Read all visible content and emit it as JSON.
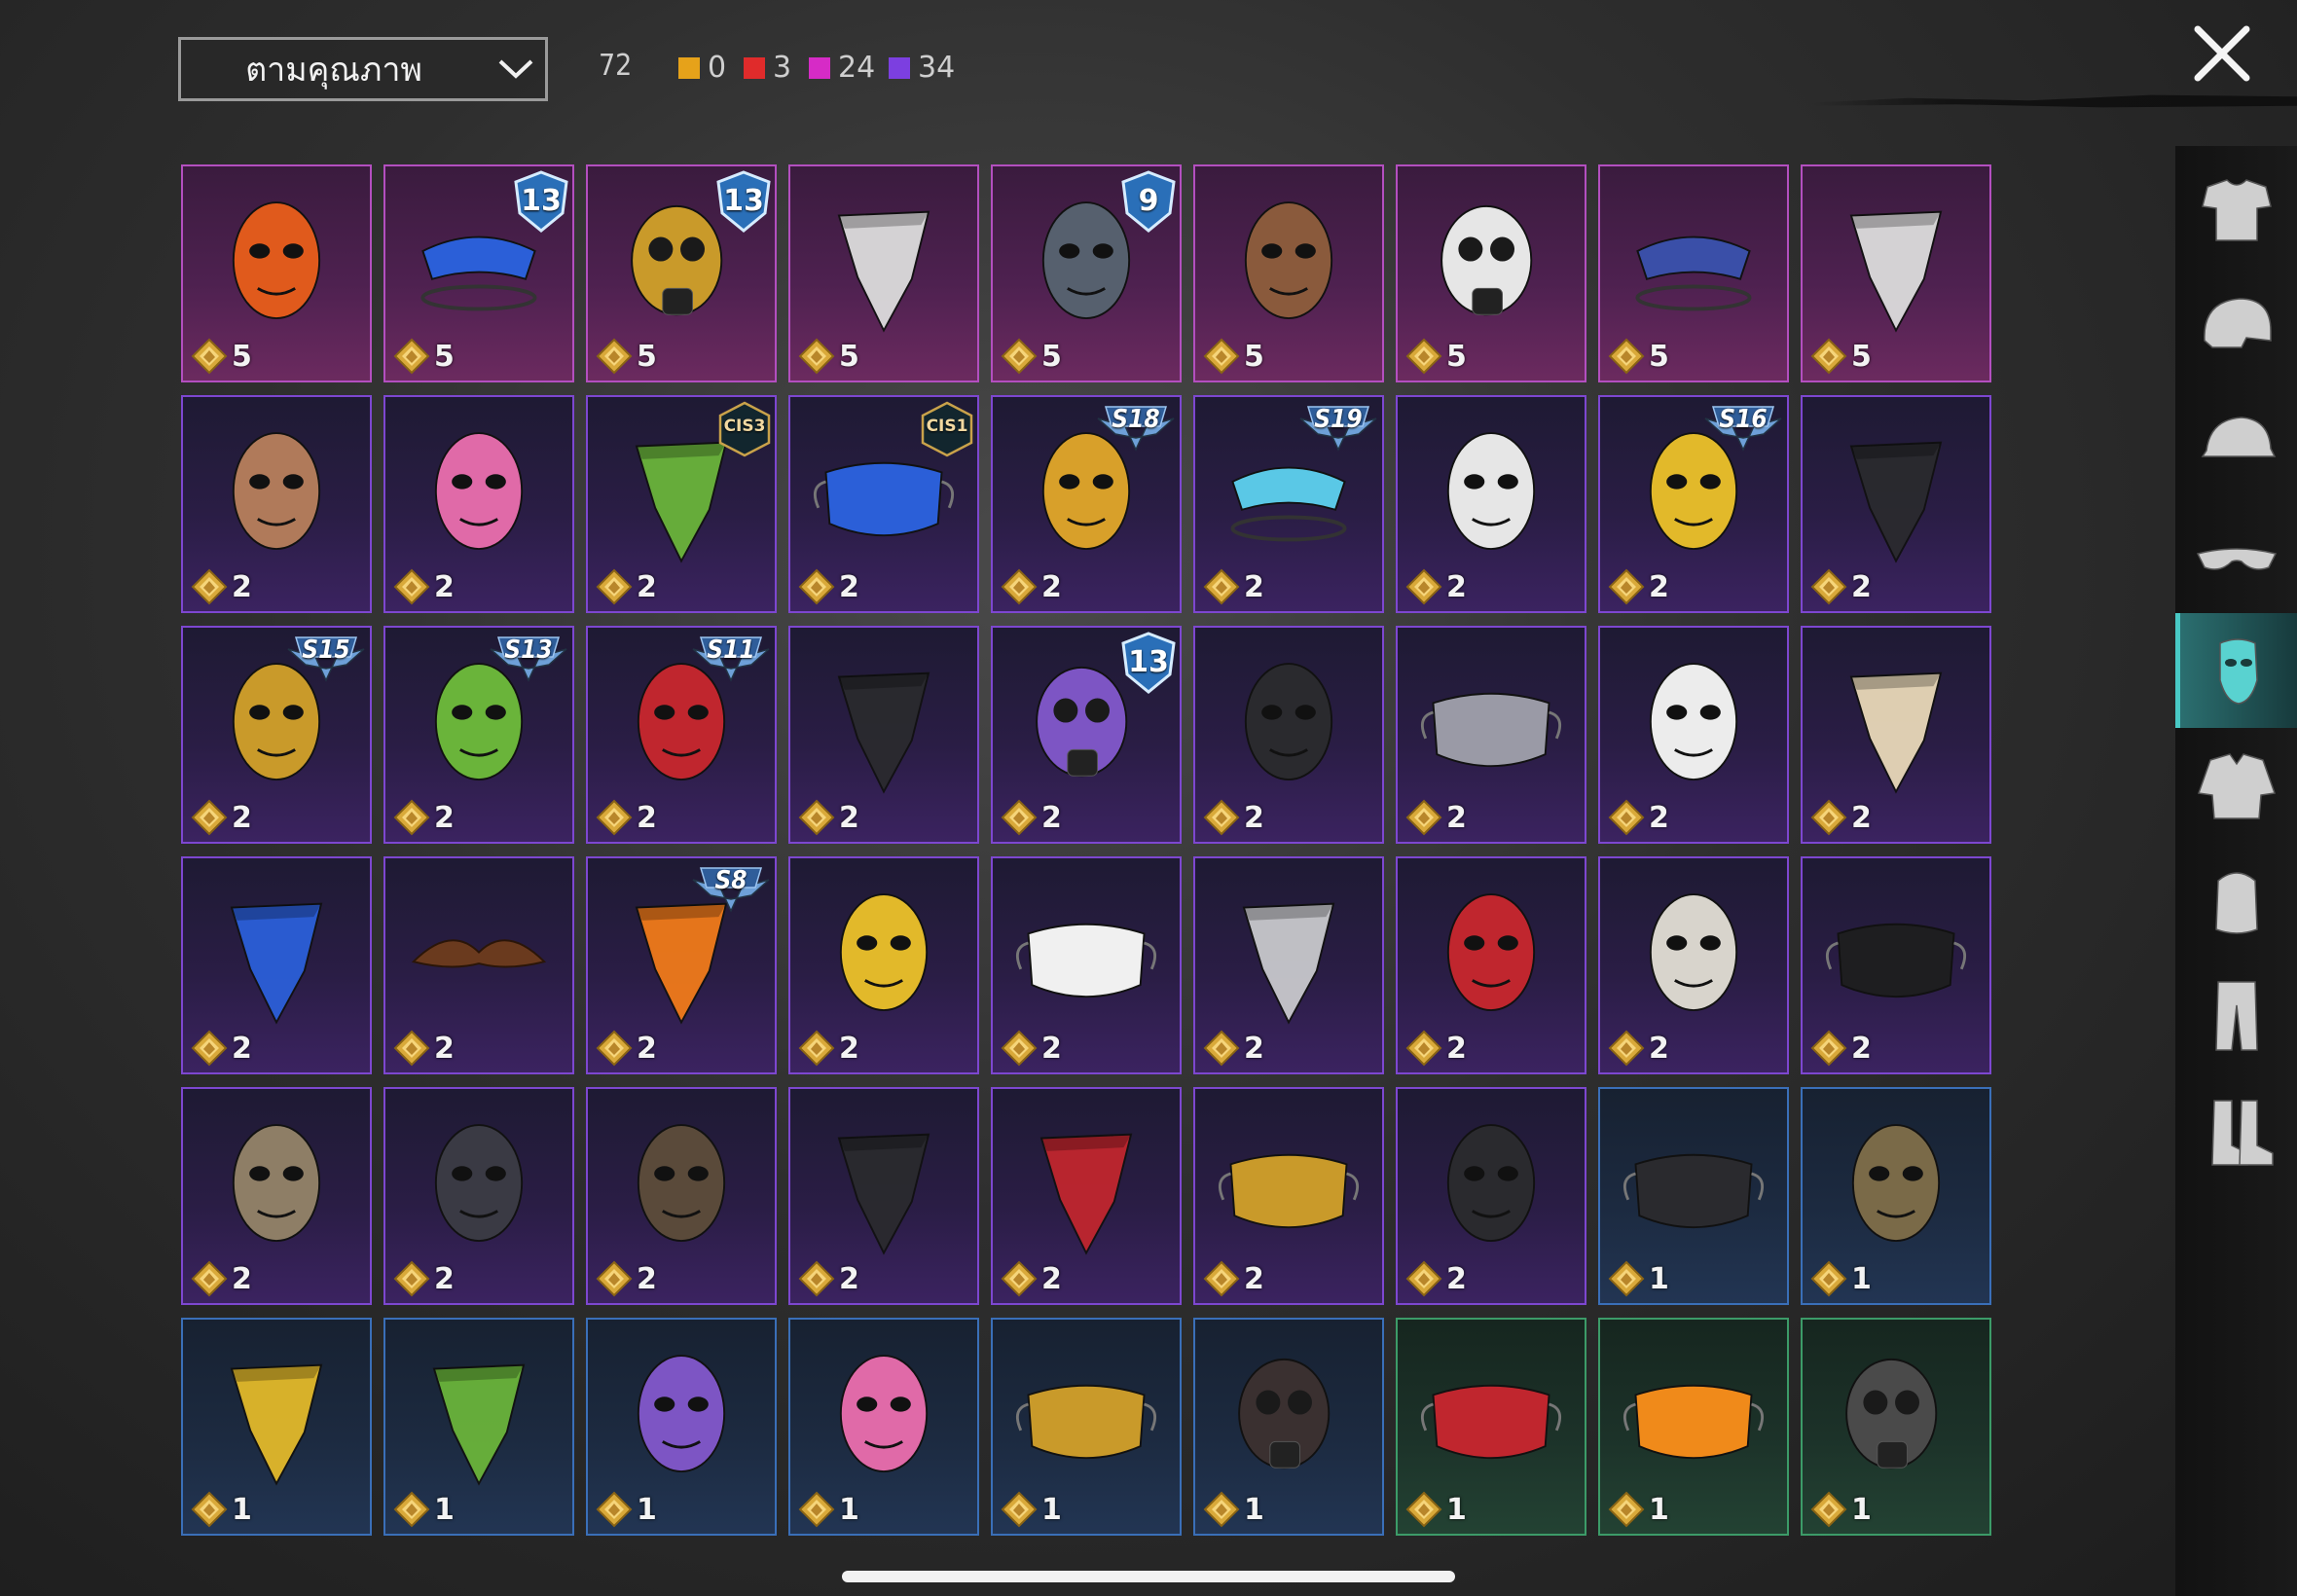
{
  "header": {
    "sort_label": "ตามคุณภาพ",
    "total_count": "72",
    "rarity_counts": [
      {
        "color": "#e6a21a",
        "count": "0"
      },
      {
        "color": "#e02b2b",
        "count": "3"
      },
      {
        "color": "#d62bc6",
        "count": "24"
      },
      {
        "color": "#7c3fe0",
        "count": "34"
      }
    ]
  },
  "items": [
    {
      "rarity": "legendary",
      "qty": "5",
      "icon": "orange-skull-mask-icon"
    },
    {
      "rarity": "legendary",
      "qty": "5",
      "icon": "blue-visor-mask-icon",
      "badge": {
        "type": "shield",
        "text": "13"
      }
    },
    {
      "rarity": "legendary",
      "qty": "5",
      "icon": "gold-respirator-mask-icon",
      "badge": {
        "type": "shield",
        "text": "13"
      }
    },
    {
      "rarity": "legendary",
      "qty": "5",
      "icon": "skull-red-bandana-icon"
    },
    {
      "rarity": "legendary",
      "qty": "5",
      "icon": "armored-knight-mask-icon",
      "badge": {
        "type": "shield",
        "text": "9"
      }
    },
    {
      "rarity": "legendary",
      "qty": "5",
      "icon": "plague-doctor-mask-icon"
    },
    {
      "rarity": "legendary",
      "qty": "5",
      "icon": "white-face-respirator-icon"
    },
    {
      "rarity": "legendary",
      "qty": "5",
      "icon": "galaxy-helmet-visor-icon"
    },
    {
      "rarity": "legendary",
      "qty": "5",
      "icon": "skull-black-bandana-icon"
    },
    {
      "rarity": "epic",
      "qty": "2",
      "icon": "mammoth-mask-icon"
    },
    {
      "rarity": "epic",
      "qty": "2",
      "icon": "pink-dino-mask-icon"
    },
    {
      "rarity": "epic",
      "qty": "2",
      "icon": "green-cactus-bandana-icon",
      "badge": {
        "type": "hex",
        "text": "CIS3"
      }
    },
    {
      "rarity": "epic",
      "qty": "2",
      "icon": "blue-white-face-mask-icon",
      "badge": {
        "type": "hex",
        "text": "CIS1"
      }
    },
    {
      "rarity": "epic",
      "qty": "2",
      "icon": "heartbeat-mask-icon",
      "badge": {
        "type": "wing",
        "text": "S18"
      }
    },
    {
      "rarity": "epic",
      "qty": "2",
      "icon": "cyan-visor-glasses-icon",
      "badge": {
        "type": "wing",
        "text": "S19"
      }
    },
    {
      "rarity": "epic",
      "qty": "2",
      "icon": "white-half-mask-icon"
    },
    {
      "rarity": "epic",
      "qty": "2",
      "icon": "yellow-goggle-mask-icon",
      "badge": {
        "type": "wing",
        "text": "S16"
      }
    },
    {
      "rarity": "epic",
      "qty": "2",
      "icon": "black-orange-bandana-icon"
    },
    {
      "rarity": "epic",
      "qty": "2",
      "icon": "gold-horned-skull-icon",
      "badge": {
        "type": "wing",
        "text": "S15"
      }
    },
    {
      "rarity": "epic",
      "qty": "2",
      "icon": "green-goggle-mask-icon",
      "badge": {
        "type": "wing",
        "text": "S13"
      }
    },
    {
      "rarity": "epic",
      "qty": "2",
      "icon": "red-half-mask-icon",
      "badge": {
        "type": "wing",
        "text": "S11"
      }
    },
    {
      "rarity": "epic",
      "qty": "2",
      "icon": "black-stitched-bandana-icon"
    },
    {
      "rarity": "epic",
      "qty": "2",
      "icon": "purple-respirator-mask-icon",
      "badge": {
        "type": "shield",
        "text": "13"
      }
    },
    {
      "rarity": "epic",
      "qty": "2",
      "icon": "black-balaclava-icon"
    },
    {
      "rarity": "epic",
      "qty": "2",
      "icon": "cyber-face-mask-icon"
    },
    {
      "rarity": "epic",
      "qty": "2",
      "icon": "clown-mask-icon"
    },
    {
      "rarity": "epic",
      "qty": "2",
      "icon": "cream-blue-bandana-icon"
    },
    {
      "rarity": "epic",
      "qty": "2",
      "icon": "blue-paisley-bandana-icon"
    },
    {
      "rarity": "epic",
      "qty": "2",
      "icon": "mustache-icon"
    },
    {
      "rarity": "epic",
      "qty": "2",
      "icon": "flame-bandana-icon",
      "badge": {
        "type": "wing",
        "text": "S8"
      }
    },
    {
      "rarity": "epic",
      "qty": "2",
      "icon": "yellow-studded-mask-icon"
    },
    {
      "rarity": "epic",
      "qty": "2",
      "icon": "grin-face-mask-icon"
    },
    {
      "rarity": "epic",
      "qty": "2",
      "icon": "silver-red-bandana-icon"
    },
    {
      "rarity": "epic",
      "qty": "2",
      "icon": "red-tengu-mask-icon"
    },
    {
      "rarity": "epic",
      "qty": "2",
      "icon": "hockey-mask-icon"
    },
    {
      "rarity": "epic",
      "qty": "2",
      "icon": "shark-teeth-mask-icon"
    },
    {
      "rarity": "epic",
      "qty": "2",
      "icon": "rusty-skull-mask-icon"
    },
    {
      "rarity": "epic",
      "qty": "2",
      "icon": "dark-steel-skull-mask-icon"
    },
    {
      "rarity": "epic",
      "qty": "2",
      "icon": "leather-muzzle-icon"
    },
    {
      "rarity": "epic",
      "qty": "2",
      "icon": "black-bandana-icon"
    },
    {
      "rarity": "epic",
      "qty": "2",
      "icon": "red-scarf-icon"
    },
    {
      "rarity": "epic",
      "qty": "2",
      "icon": "gold-glitter-mask-icon"
    },
    {
      "rarity": "epic",
      "qty": "2",
      "icon": "black-riot-face-icon"
    },
    {
      "rarity": "rare",
      "qty": "1",
      "icon": "black-logo-face-mask-icon"
    },
    {
      "rarity": "rare",
      "qty": "1",
      "icon": "camo-skull-mask-icon"
    },
    {
      "rarity": "rare",
      "qty": "1",
      "icon": "yellow-dots-bandana-icon"
    },
    {
      "rarity": "rare",
      "qty": "1",
      "icon": "green-web-bandana-icon"
    },
    {
      "rarity": "rare",
      "qty": "1",
      "icon": "purple-theater-mask-icon"
    },
    {
      "rarity": "rare",
      "qty": "1",
      "icon": "pink-gold-theater-mask-icon"
    },
    {
      "rarity": "rare",
      "qty": "1",
      "icon": "gold-print-face-mask-icon"
    },
    {
      "rarity": "rare",
      "qty": "1",
      "icon": "half-face-respirator-icon"
    },
    {
      "rarity": "uncommon",
      "qty": "1",
      "icon": "red-teeth-face-mask-icon"
    },
    {
      "rarity": "uncommon",
      "qty": "1",
      "icon": "fire-face-mask-icon"
    },
    {
      "rarity": "uncommon",
      "qty": "1",
      "icon": "gas-mask-icon"
    }
  ],
  "sidebar": [
    {
      "icon": "outfit-icon"
    },
    {
      "icon": "helmet-icon"
    },
    {
      "icon": "cap-icon"
    },
    {
      "icon": "glasses-icon"
    },
    {
      "icon": "mask-icon",
      "active": true
    },
    {
      "icon": "jacket-icon"
    },
    {
      "icon": "backpack-icon"
    },
    {
      "icon": "pants-icon"
    },
    {
      "icon": "boots-icon"
    }
  ]
}
